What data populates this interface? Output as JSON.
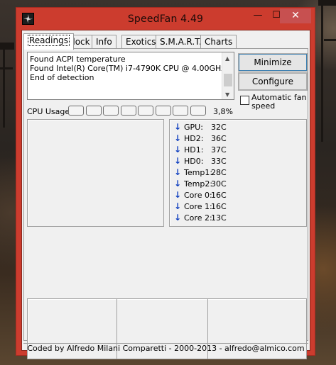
{
  "window": {
    "title": "SpeedFan 4.49",
    "minimize_glyph": "—",
    "maximize_glyph": "☐",
    "close_glyph": "✕"
  },
  "tabs": [
    {
      "label": "Readings",
      "active": true
    },
    {
      "label": "Clock"
    },
    {
      "label": "Info"
    },
    {
      "label": "Exotics"
    },
    {
      "label": "S.M.A.R.T."
    },
    {
      "label": "Charts"
    }
  ],
  "log": {
    "lines": [
      "Found ACPI temperature",
      "Found Intel(R) Core(TM) i7-4790K CPU @ 4.00GHz",
      "End of detection"
    ]
  },
  "buttons": {
    "minimize": "Minimize",
    "configure": "Configure",
    "auto_fan": "Automatic fan speed",
    "auto_fan_checked": false
  },
  "cpu": {
    "label": "CPU Usage",
    "value": "3,8%",
    "usage_fraction": 0.038,
    "segments": 8
  },
  "temps": [
    {
      "name": "GPU:",
      "value": "32C",
      "trend": "down"
    },
    {
      "name": "HD2:",
      "value": "36C",
      "trend": "down"
    },
    {
      "name": "HD1:",
      "value": "37C",
      "trend": "down"
    },
    {
      "name": "HD0:",
      "value": "33C",
      "trend": "down"
    },
    {
      "name": "Temp1:",
      "value": "28C",
      "trend": "down"
    },
    {
      "name": "Temp2:",
      "value": "30C",
      "trend": "down"
    },
    {
      "name": "Core 0:",
      "value": "16C",
      "trend": "down"
    },
    {
      "name": "Core 1:",
      "value": "16C",
      "trend": "down"
    },
    {
      "name": "Core 2:",
      "value": "13C",
      "trend": "down"
    }
  ],
  "footer": "Coded by Alfredo Milani Comparetti - 2000-2013 - alfredo@almico.com",
  "colors": {
    "titlebar": "#cc3c2e",
    "close_button": "#c75050",
    "trend_arrow": "#1040c0"
  }
}
